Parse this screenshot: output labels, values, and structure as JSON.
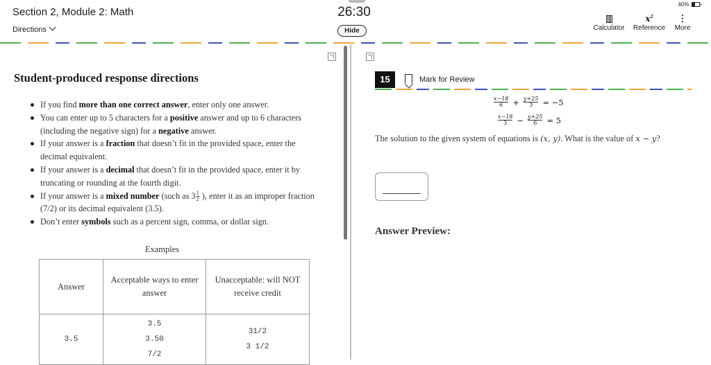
{
  "header": {
    "section_title": "Section 2, Module 2: Math",
    "directions_label": "Directions",
    "timer": "26:30",
    "hide_label": "Hide",
    "battery": "40%",
    "tools": {
      "calculator": "Calculator",
      "reference": "Reference",
      "more": "More"
    },
    "icons": [
      "chevron-down-icon",
      "calculator-icon",
      "reference-icon",
      "more-icon",
      "battery-icon"
    ]
  },
  "directions": {
    "heading": "Student-produced response directions",
    "bullets": [
      [
        "If you find ",
        "more than one correct answer",
        ", enter only one answer."
      ],
      [
        "You can enter up to 5 characters for a ",
        "positive",
        " answer and up to 6 characters (including the negative sign) for a ",
        "negative",
        " answer."
      ],
      [
        "If your answer is a ",
        "fraction",
        " that doesn’t fit in the provided space, enter the decimal equivalent."
      ],
      [
        "If your answer is a ",
        "decimal",
        " that doesn’t fit in the provided space, enter it by truncating or rounding at the fourth digit."
      ],
      [
        "If your answer is a ",
        "mixed number",
        " (such as 3",
        "1",
        "2",
        " ), enter it as an improper fraction (7/2) or its decimal equivalent (3.5)."
      ],
      [
        "Don’t enter ",
        "symbols",
        " such as a percent sign, comma, or dollar sign."
      ]
    ],
    "examples_caption": "Examples",
    "table": {
      "headers": [
        "Answer",
        "Acceptable ways to enter answer",
        "Unacceptable: will NOT receive credit"
      ],
      "rows": [
        {
          "answer": "3.5",
          "acceptable": [
            "3.5",
            "3.50",
            "7/2"
          ],
          "unacceptable": [
            "31/2",
            "3 1/2"
          ]
        }
      ]
    }
  },
  "question": {
    "number": "15",
    "mark_label": "Mark for Review",
    "eq1": {
      "a_num": "x−18",
      "a_den": "6",
      "op": "+",
      "b_num": "y+25",
      "b_den": "3",
      "rhs": "= −5"
    },
    "eq2": {
      "a_num": "x−18",
      "a_den": "3",
      "op": "−",
      "b_num": "y+25",
      "b_den": "6",
      "rhs": "= 5"
    },
    "text_1": "The solution to the given system of equations is ",
    "text_var": "(x, y)",
    "text_2": ". What is the value of ",
    "text_expr": "x − y",
    "text_3": "?",
    "preview_label": "Answer Preview:"
  },
  "colors": {
    "dash_green": "#4caf50",
    "dash_orange": "#f2a23a",
    "dash_blue": "#3f51b5",
    "question_badge": "#111111"
  }
}
